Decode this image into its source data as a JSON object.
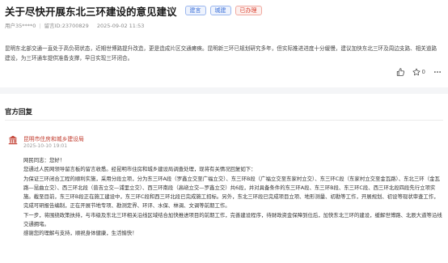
{
  "header": {
    "title": "关于尽快开展东北三环建设的意见建议",
    "tags": [
      {
        "label": "建言",
        "color": "#3a6fd8"
      },
      {
        "label": "城建",
        "color": "#3a6fd8"
      },
      {
        "label": "已办理",
        "color": "#d9412f"
      }
    ]
  },
  "meta": {
    "user": "用户35****0",
    "message_id": "留言ID:23700829",
    "datetime": "2025-09-02 11:53"
  },
  "content": "昆明东北部交通一直处于高负荷状态，近期世博路提升改造，更是造成片区交通瘫痪。昆明新三环已规划研究多年，但实际推进进度十分缓慢，建议加快东北三环及周边支路、相关道路建设，为三环通车提供准备支撑，早日实现三环闭合。",
  "actions": {
    "like_icon": "thumbs-up-icon",
    "star_icon": "star-icon",
    "star_count": "0",
    "more_icon": "more-icon"
  },
  "reply_section": {
    "title": "官方回复",
    "department": "昆明市住房和城乡建设局",
    "department_icon": "government-building-icon",
    "time": "2025-10-10 19:01",
    "paragraphs": [
      "网民同志：您好！",
      "您通过人民网领导留言板的留言收悉。经昆明市住房和城乡建设局调查处理，现将有关情况回复如下：",
      "为保证三环闭合工程的顺利实施，采用分段立项，分为东三环A段（罗鑫立交至广福立交）、东三环B段（广福立交至东家村立交）、东三环C段（东家村立交至金瓦路）、东北三环（金瓦路—昆曲立交）、西三环北段（普吉立交—浦里立交）、西三环南段（高峣立交—罗鑫立交）共6段，并对具备条件的东三环A段、东三环B段、东三环C段、西三环北段四段先行立项实施。截至目前，东三环B段正在施工建设中，东三环C段和西三环北段已完成施工招标。另外，东北三环段已完成项目立项、地形测量、初勘等工作，开展规划、初设等现状审查工作，完成可研报告编制，正在开展节地专项、勘测定界、环评、水保、林调、文调等前期工作。",
      "下一步，将围绕政策扶持，与市级及东北三环相关沿线区域结合加快推进项目的前期工作，完善建设程序，待财政资金保障到位后，加快东北三环的建设，缓解世博路、北辰大道等沿线交通拥堵。",
      "感谢您的理解与支持，顺祝身体健康，生活愉快！"
    ]
  }
}
